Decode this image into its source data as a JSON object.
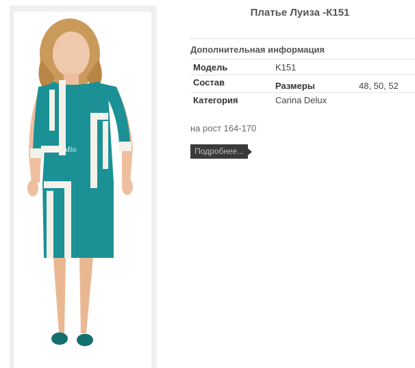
{
  "product": {
    "title": "Платье Луиза -К151",
    "image_watermark": "Per Mio",
    "image_alt": "Платье Луиза -К151"
  },
  "info": {
    "heading": "Дополнительная информация",
    "rows": [
      {
        "label": "Модель",
        "value": "K151"
      },
      {
        "label": "Состав",
        "value": ""
      },
      {
        "label": "Категория",
        "value": "Carina Delux"
      }
    ],
    "sizes_label": "Размеры",
    "sizes_value": "48, 50, 52"
  },
  "height_note": "на рост 164-170",
  "more_button": "Подробнее...",
  "colors": {
    "dress": "#1b9196",
    "panel": "#f4f1ea",
    "button_bg": "#3a3a3a"
  }
}
